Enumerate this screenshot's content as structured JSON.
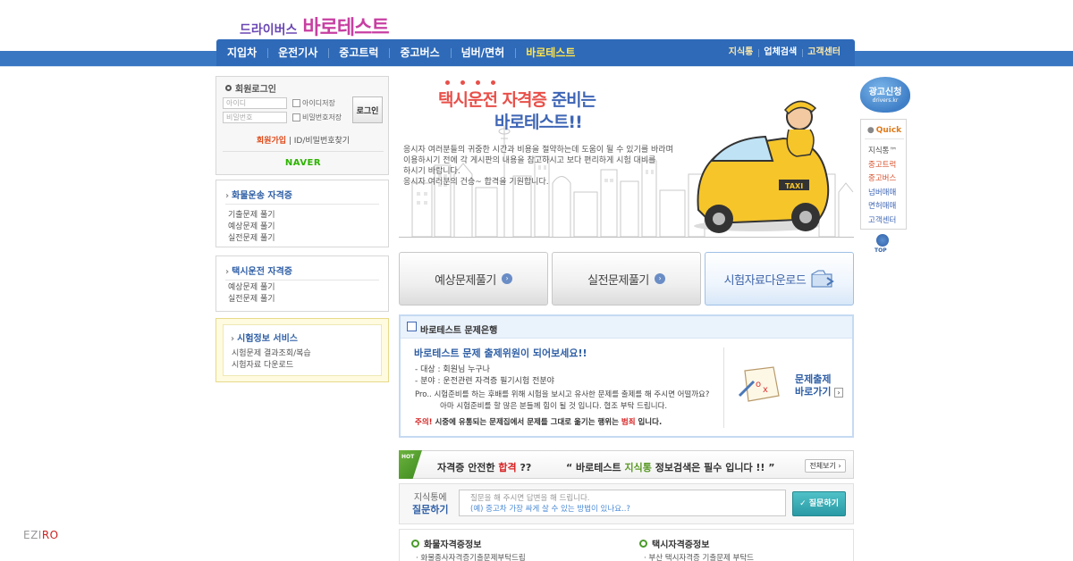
{
  "logo": {
    "prefix": "드라이버스",
    "name": "바로테스트"
  },
  "nav": {
    "items": [
      "지입차",
      "운전기사",
      "중고트럭",
      "중고버스",
      "넘버/면허",
      "바로테스트"
    ],
    "sub": [
      "지식통",
      "업체검색",
      "고객센터"
    ]
  },
  "login": {
    "title": "회원로그인",
    "id_placeholder": "아이디",
    "pw_placeholder": "비밀번호",
    "save_id": "아이디저장",
    "save_pw": "비밀번호저장",
    "button": "로그인",
    "join": "회원가입",
    "find": "ID/비밀번호찾기",
    "naver": "NAVER"
  },
  "side_freight": {
    "title": "화물운송 자격증",
    "links": [
      "기출문제 풀기",
      "예상문제 풀기",
      "실전문제 풀기"
    ]
  },
  "side_taxi": {
    "title": "택시운전 자격증",
    "links": [
      "예상문제 풀기",
      "실전문제 풀기"
    ]
  },
  "side_exam": {
    "title": "시험정보 서비스",
    "links": [
      "시험문제 결과조회/복습",
      "시험자료 다운로드"
    ]
  },
  "hero": {
    "title1_a": "택시운전 자격증",
    "title1_b": " 준비는",
    "title2": "바로테스트!!",
    "text": [
      "응시자 여러분들의 귀중한 시간과 비용을 절약하는데 도움이 될 수 있기를 바라며",
      "이용하시기  전에 각 게시판의 내용을 참고하시고 보다 편리하게 시험 대비를",
      "하시기 바랍니다.",
      "응시자 여러분의 건승~ 합격을 기원합니다."
    ],
    "taxi_sign": "TAXI"
  },
  "buttons": [
    "예상문제풀기",
    "실전문제풀기",
    "시험자료다운로드"
  ],
  "bank": {
    "head": "바로테스트 문제은행",
    "sub": "바로테스트 문제 출제위원이 되어보세요!!",
    "target": "- 대상 : 회원님 누구나",
    "field": "- 분야 : 운전관련 자격증 필기시험 전분야",
    "pro1": "Pro..  시험준비를 하는 후배를 위해 시험을 보시고 유사한 문제를 출제를 해 주시면 어떨까요?",
    "pro2": "아마 시험준비를 할 많은 분들께 힘이 될 것 입니다. 협조 부탁 드립니다.",
    "warn_red": "주의!",
    "warn_a": " 시중에 유통되는 문제집에서 문제를 그대로 옮기는 행위는 ",
    "warn_red2": "범죄",
    "warn_b": " 입니다.",
    "go1": "문제출제",
    "go2": "바로가기"
  },
  "kbar": {
    "hot": "HOT",
    "t1": "자격증 안전한 ",
    "t1_red": "합격",
    "t1_end": " ??",
    "t2_a": "“  바로테스트 ",
    "t2_green": "지식통",
    "t2_b": " 정보검색은 필수 입니다 !! ”",
    "btn": "전체보기"
  },
  "question": {
    "label1": "지식통에",
    "label2": "질문하기",
    "line1": "질문을 해 주시면 답변을 해 드립니다.",
    "line2": "(예) 중고차 가장 싸게 살 수 있는 방법이 있나요..?",
    "btn": "질문하기"
  },
  "info": {
    "col1_title": "화물자격증정보",
    "col1_line": "· 화물종사자격증기출문제부탁드립",
    "col2_title": "택시자격증정보",
    "col2_line": "· 부산 택시자격증 기출문제 부탁드"
  },
  "ad": {
    "t1": "광고신청",
    "t2": "drivers.kr"
  },
  "quick": {
    "title": "Quick",
    "items": [
      "지식통™",
      "중고트럭",
      "중고버스",
      "넘버매매",
      "면허매매",
      "고객센터"
    ]
  },
  "top": "TOP",
  "watermark": {
    "a": "EZI",
    "b": "RO"
  },
  "colors": {
    "nav": "#2e6ab8",
    "band": "#3a77c3",
    "accent_red": "#e8504a",
    "accent_blue": "#3f66b5"
  }
}
